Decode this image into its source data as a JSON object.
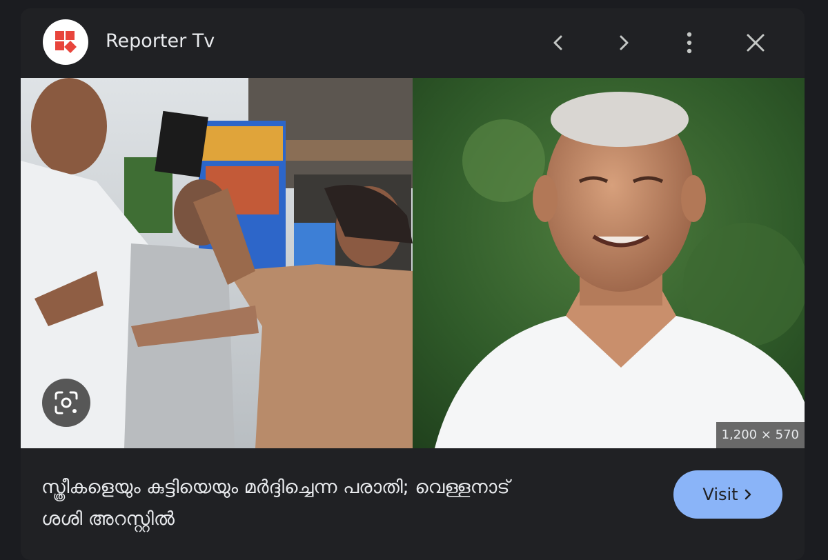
{
  "source": {
    "name": "Reporter Tv",
    "logo_icon": "reporter-tv-logo",
    "brand_color": "#e8453c"
  },
  "header_buttons": {
    "prev_icon": "chevron-left-icon",
    "next_icon": "chevron-right-icon",
    "more_icon": "more-vertical-icon",
    "close_icon": "close-icon"
  },
  "image": {
    "dimensions": "1,200 × 570",
    "lens_icon": "lens-search-icon"
  },
  "headline": {
    "line1": "സ്ത്രീകളെയും കുട്ടിയെയും മർദ്ദിച്ചെന്ന പരാതി; വെള്ളനാട്",
    "line2": "ശശി അറസ്റ്റിൽ"
  },
  "visit_button": {
    "label": "Visit",
    "icon": "chevron-right-icon",
    "color": "#8ab4f8"
  },
  "colors": {
    "background": "#1b1c20",
    "panel": "#202124",
    "text": "#e8eaed"
  }
}
